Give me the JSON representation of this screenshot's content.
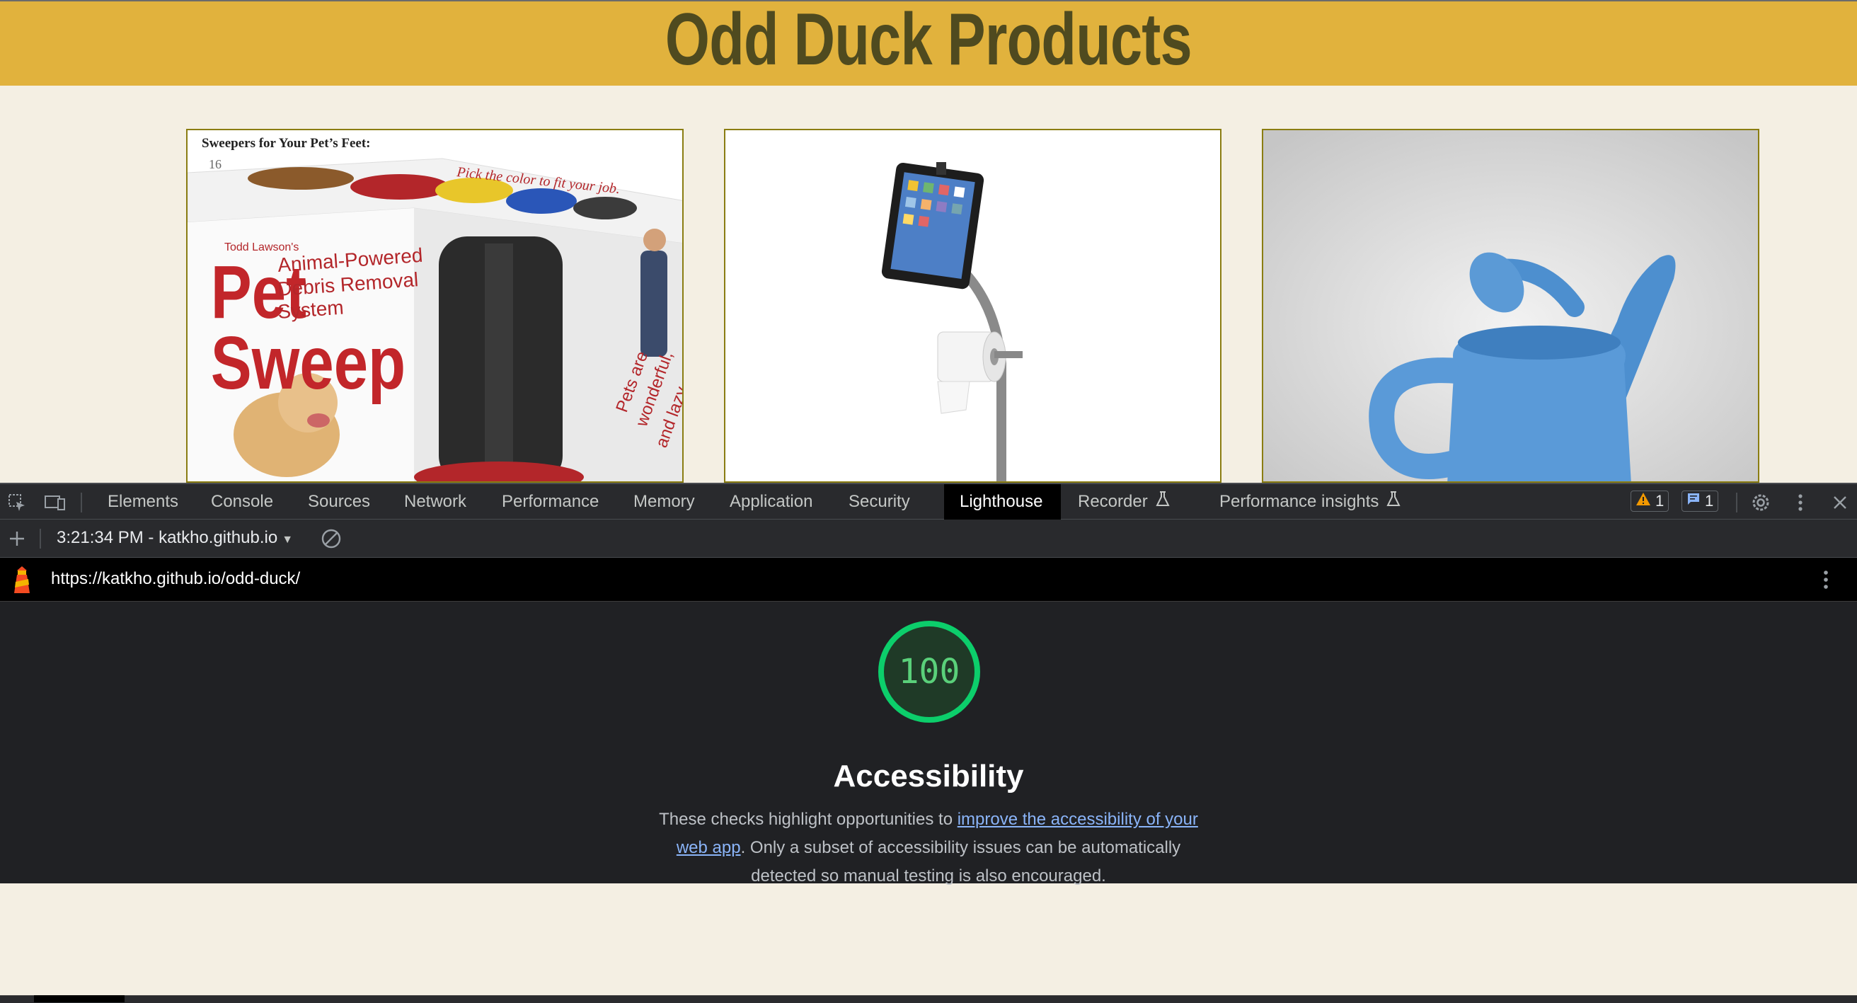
{
  "page": {
    "title": "Odd Duck Products",
    "cards": [
      {
        "name": "pet-sweep",
        "caption": "Sweepers for Your Pet’s Feet:",
        "pagenum": "16",
        "box_lines": [
          "Todd Lawson's",
          "Pet",
          "Sweep",
          "Animal-Powered",
          "Debris Removal",
          "System",
          "Pick the color to fit your job.",
          "Pets are",
          "wonderful,",
          "and lazy."
        ]
      },
      {
        "name": "tablet-toilet-paper-stand"
      },
      {
        "name": "watering-can"
      }
    ]
  },
  "devtools": {
    "tabs": [
      {
        "label": "Elements",
        "active": false
      },
      {
        "label": "Console",
        "active": false
      },
      {
        "label": "Sources",
        "active": false
      },
      {
        "label": "Network",
        "active": false
      },
      {
        "label": "Performance",
        "active": false
      },
      {
        "label": "Memory",
        "active": false
      },
      {
        "label": "Application",
        "active": false
      },
      {
        "label": "Security",
        "active": false
      },
      {
        "label": "Lighthouse",
        "active": true
      },
      {
        "label": "Recorder",
        "active": false,
        "experimental": true
      },
      {
        "label": "Performance insights",
        "active": false,
        "experimental": true
      }
    ],
    "warnings_count": "1",
    "messages_count": "1",
    "report_selector": "3:21:34 PM - katkho.github.io",
    "report_url": "https://katkho.github.io/odd-duck/",
    "score": {
      "value": "100",
      "fraction": 1.0,
      "category": "Accessibility",
      "desc_before": "These checks highlight opportunities to ",
      "desc_link": "improve the accessibility of your web app",
      "desc_after": ". Only a subset of accessibility issues can be automatically detected so manual testing is also encouraged."
    },
    "colors": {
      "pass": "#0cce6b",
      "active_tab_bg": "#000000",
      "header_bg": "#e1b23d"
    }
  }
}
